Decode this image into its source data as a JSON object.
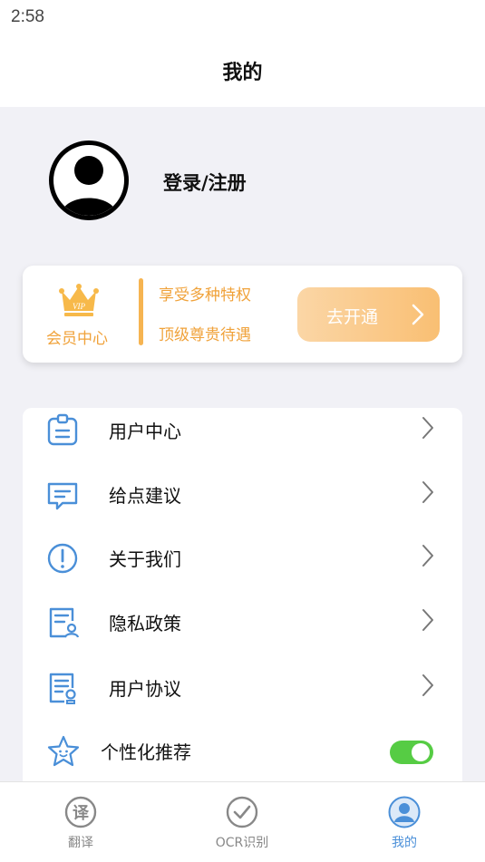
{
  "status_bar": {
    "time": "2:58"
  },
  "header": {
    "title": "我的"
  },
  "profile": {
    "login_label": "登录/注册"
  },
  "vip": {
    "badge_text": "VIP",
    "center_label": "会员中心",
    "line1": "享受多种特权",
    "line2": "顶级尊贵待遇",
    "button_label": "去开通",
    "accent_color": "#f0a23a"
  },
  "menu": {
    "items": [
      {
        "label": "用户中心",
        "icon": "user-center-icon"
      },
      {
        "label": "给点建议",
        "icon": "feedback-icon"
      },
      {
        "label": "关于我们",
        "icon": "info-icon"
      },
      {
        "label": "隐私政策",
        "icon": "privacy-icon"
      },
      {
        "label": "用户协议",
        "icon": "agreement-icon"
      },
      {
        "label": "个性化推荐",
        "icon": "star-icon",
        "toggle_on": true
      }
    ],
    "icon_color": "#4a8fd8",
    "toggle_color": "#56cc44"
  },
  "tabbar": {
    "tabs": [
      {
        "label": "翻译",
        "icon": "translate-icon",
        "active": false
      },
      {
        "label": "OCR识别",
        "icon": "check-circle-icon",
        "active": false
      },
      {
        "label": "我的",
        "icon": "profile-icon",
        "active": true
      }
    ],
    "active_color": "#4a8fd8"
  }
}
